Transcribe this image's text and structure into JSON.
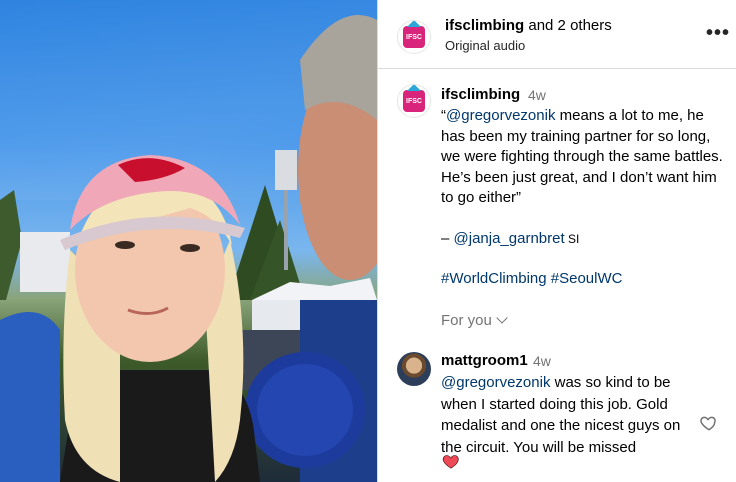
{
  "header": {
    "user": "ifsclimbing",
    "others": "and 2 others",
    "audio": "Original audio",
    "more_icon": "more-horizontal-icon"
  },
  "caption": {
    "user": "ifsclimbing",
    "time": "4w",
    "mention1": "@gregorvezonik",
    "text1_rest": " means a lot to me, he has been my training partner for so long, we were fighting through the same battles. He’s been just great, and I don’t want him to go either”",
    "quote_open": "“",
    "dash": "– ",
    "mention2": "@janja_garnbret",
    "suffix2": " SI",
    "tag1": "#WorldClimbing",
    "tag2": "#SeoulWC",
    "for_you": "For you"
  },
  "comment": {
    "user": "mattgroom1",
    "time": "4w",
    "mention": "@gregorvezonik",
    "text_rest": " was so kind to be when I started doing this job. Gold medalist and one the nicest guys on the circuit. You will be missed"
  },
  "colors": {
    "link": "#00376b",
    "meta": "#737373",
    "heart": "#ed4956",
    "divider": "#dbdbdb"
  }
}
